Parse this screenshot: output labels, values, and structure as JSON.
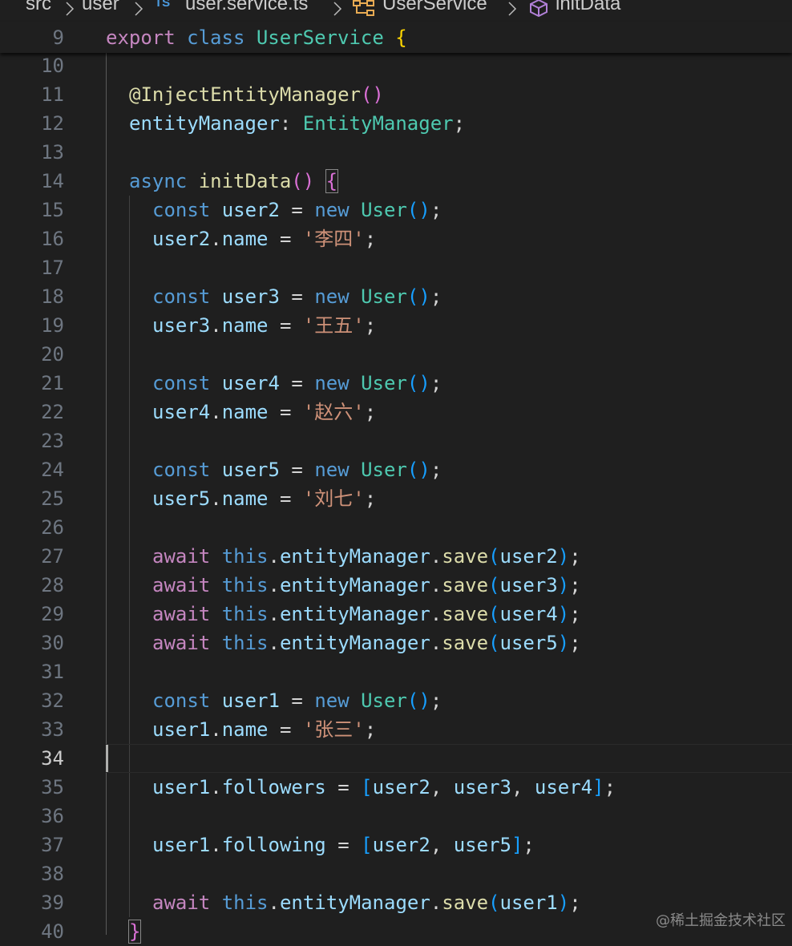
{
  "breadcrumb": {
    "items": [
      "src",
      "user",
      "user.service.ts",
      "UserService",
      "initData"
    ],
    "ts_badge": "TS"
  },
  "sticky": {
    "line_number": "9"
  },
  "lines": [
    {
      "n": "10",
      "tokens": []
    },
    {
      "n": "11",
      "tokens": [
        [
          "f",
          "@InjectEntityManager"
        ],
        [
          "p",
          "()"
        ]
      ]
    },
    {
      "n": "12",
      "tokens": [
        [
          "v",
          "entityManager"
        ],
        [
          "op",
          ": "
        ],
        [
          "c",
          "EntityManager"
        ],
        [
          "op",
          ";"
        ]
      ]
    },
    {
      "n": "13",
      "tokens": []
    },
    {
      "n": "14",
      "tokens": [
        [
          "s",
          "async "
        ],
        [
          "f",
          "initData"
        ],
        [
          "p",
          "() "
        ],
        [
          "p",
          "{"
        ]
      ]
    },
    {
      "n": "15",
      "tokens": [
        [
          "s",
          "const "
        ],
        [
          "v",
          "user2"
        ],
        [
          "op",
          " = "
        ],
        [
          "s",
          "new "
        ],
        [
          "c",
          "User"
        ],
        [
          "b",
          "()"
        ],
        [
          "op",
          ";"
        ]
      ]
    },
    {
      "n": "16",
      "tokens": [
        [
          "v",
          "user2"
        ],
        [
          "op",
          "."
        ],
        [
          "v",
          "name"
        ],
        [
          "op",
          " = "
        ],
        [
          "str",
          "'李四'"
        ],
        [
          "op",
          ";"
        ]
      ]
    },
    {
      "n": "17",
      "tokens": []
    },
    {
      "n": "18",
      "tokens": [
        [
          "s",
          "const "
        ],
        [
          "v",
          "user3"
        ],
        [
          "op",
          " = "
        ],
        [
          "s",
          "new "
        ],
        [
          "c",
          "User"
        ],
        [
          "b",
          "()"
        ],
        [
          "op",
          ";"
        ]
      ]
    },
    {
      "n": "19",
      "tokens": [
        [
          "v",
          "user3"
        ],
        [
          "op",
          "."
        ],
        [
          "v",
          "name"
        ],
        [
          "op",
          " = "
        ],
        [
          "str",
          "'王五'"
        ],
        [
          "op",
          ";"
        ]
      ]
    },
    {
      "n": "20",
      "tokens": []
    },
    {
      "n": "21",
      "tokens": [
        [
          "s",
          "const "
        ],
        [
          "v",
          "user4"
        ],
        [
          "op",
          " = "
        ],
        [
          "s",
          "new "
        ],
        [
          "c",
          "User"
        ],
        [
          "b",
          "()"
        ],
        [
          "op",
          ";"
        ]
      ]
    },
    {
      "n": "22",
      "tokens": [
        [
          "v",
          "user4"
        ],
        [
          "op",
          "."
        ],
        [
          "v",
          "name"
        ],
        [
          "op",
          " = "
        ],
        [
          "str",
          "'赵六'"
        ],
        [
          "op",
          ";"
        ]
      ]
    },
    {
      "n": "23",
      "tokens": []
    },
    {
      "n": "24",
      "tokens": [
        [
          "s",
          "const "
        ],
        [
          "v",
          "user5"
        ],
        [
          "op",
          " = "
        ],
        [
          "s",
          "new "
        ],
        [
          "c",
          "User"
        ],
        [
          "b",
          "()"
        ],
        [
          "op",
          ";"
        ]
      ]
    },
    {
      "n": "25",
      "tokens": [
        [
          "v",
          "user5"
        ],
        [
          "op",
          "."
        ],
        [
          "v",
          "name"
        ],
        [
          "op",
          " = "
        ],
        [
          "str",
          "'刘七'"
        ],
        [
          "op",
          ";"
        ]
      ]
    },
    {
      "n": "26",
      "tokens": []
    },
    {
      "n": "27",
      "tokens": [
        [
          "k",
          "await "
        ],
        [
          "s",
          "this"
        ],
        [
          "op",
          "."
        ],
        [
          "v",
          "entityManager"
        ],
        [
          "op",
          "."
        ],
        [
          "f",
          "save"
        ],
        [
          "b",
          "("
        ],
        [
          "v",
          "user2"
        ],
        [
          "b",
          ")"
        ],
        [
          "op",
          ";"
        ]
      ]
    },
    {
      "n": "28",
      "tokens": [
        [
          "k",
          "await "
        ],
        [
          "s",
          "this"
        ],
        [
          "op",
          "."
        ],
        [
          "v",
          "entityManager"
        ],
        [
          "op",
          "."
        ],
        [
          "f",
          "save"
        ],
        [
          "b",
          "("
        ],
        [
          "v",
          "user3"
        ],
        [
          "b",
          ")"
        ],
        [
          "op",
          ";"
        ]
      ]
    },
    {
      "n": "29",
      "tokens": [
        [
          "k",
          "await "
        ],
        [
          "s",
          "this"
        ],
        [
          "op",
          "."
        ],
        [
          "v",
          "entityManager"
        ],
        [
          "op",
          "."
        ],
        [
          "f",
          "save"
        ],
        [
          "b",
          "("
        ],
        [
          "v",
          "user4"
        ],
        [
          "b",
          ")"
        ],
        [
          "op",
          ";"
        ]
      ]
    },
    {
      "n": "30",
      "tokens": [
        [
          "k",
          "await "
        ],
        [
          "s",
          "this"
        ],
        [
          "op",
          "."
        ],
        [
          "v",
          "entityManager"
        ],
        [
          "op",
          "."
        ],
        [
          "f",
          "save"
        ],
        [
          "b",
          "("
        ],
        [
          "v",
          "user5"
        ],
        [
          "b",
          ")"
        ],
        [
          "op",
          ";"
        ]
      ]
    },
    {
      "n": "31",
      "tokens": []
    },
    {
      "n": "32",
      "tokens": [
        [
          "s",
          "const "
        ],
        [
          "v",
          "user1"
        ],
        [
          "op",
          " = "
        ],
        [
          "s",
          "new "
        ],
        [
          "c",
          "User"
        ],
        [
          "b",
          "()"
        ],
        [
          "op",
          ";"
        ]
      ]
    },
    {
      "n": "33",
      "tokens": [
        [
          "v",
          "user1"
        ],
        [
          "op",
          "."
        ],
        [
          "v",
          "name"
        ],
        [
          "op",
          " = "
        ],
        [
          "str",
          "'张三'"
        ],
        [
          "op",
          ";"
        ]
      ]
    },
    {
      "n": "34",
      "tokens": []
    },
    {
      "n": "35",
      "tokens": [
        [
          "v",
          "user1"
        ],
        [
          "op",
          "."
        ],
        [
          "v",
          "followers"
        ],
        [
          "op",
          " = "
        ],
        [
          "b",
          "["
        ],
        [
          "v",
          "user2"
        ],
        [
          "op",
          ", "
        ],
        [
          "v",
          "user3"
        ],
        [
          "op",
          ", "
        ],
        [
          "v",
          "user4"
        ],
        [
          "b",
          "]"
        ],
        [
          "op",
          ";"
        ]
      ]
    },
    {
      "n": "36",
      "tokens": []
    },
    {
      "n": "37",
      "tokens": [
        [
          "v",
          "user1"
        ],
        [
          "op",
          "."
        ],
        [
          "v",
          "following"
        ],
        [
          "op",
          " = "
        ],
        [
          "b",
          "["
        ],
        [
          "v",
          "user2"
        ],
        [
          "op",
          ", "
        ],
        [
          "v",
          "user5"
        ],
        [
          "b",
          "]"
        ],
        [
          "op",
          ";"
        ]
      ]
    },
    {
      "n": "38",
      "tokens": []
    },
    {
      "n": "39",
      "tokens": [
        [
          "k",
          "await "
        ],
        [
          "s",
          "this"
        ],
        [
          "op",
          "."
        ],
        [
          "v",
          "entityManager"
        ],
        [
          "op",
          "."
        ],
        [
          "f",
          "save"
        ],
        [
          "b",
          "("
        ],
        [
          "v",
          "user1"
        ],
        [
          "b",
          ")"
        ],
        [
          "op",
          ";"
        ]
      ]
    },
    {
      "n": "40",
      "tokens": [
        [
          "p",
          "}"
        ]
      ]
    }
  ],
  "active_line": "34",
  "watermark": "@稀土掘金技术社区",
  "colors": {
    "background": "#1f1f1f",
    "keyword_control": "#c586c0",
    "keyword_storage": "#569cd6",
    "class_name": "#4ec9b0",
    "variable": "#9cdcfe",
    "function": "#dcdcaa",
    "string": "#ce9178"
  }
}
